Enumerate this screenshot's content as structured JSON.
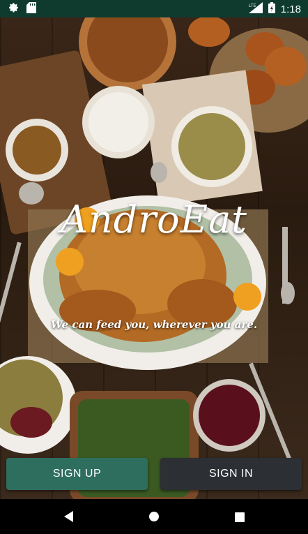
{
  "status_bar": {
    "time": "1:18",
    "network": "LTE",
    "icons": [
      "gear-icon",
      "sd-card-icon",
      "signal-icon",
      "battery-icon"
    ]
  },
  "app": {
    "title": "AndroEat",
    "tagline": "We can feed you, wherever you are."
  },
  "buttons": {
    "sign_up": "SIGN UP",
    "sign_in": "SIGN IN"
  },
  "nav": {
    "icons": [
      "back-icon",
      "home-icon",
      "recents-icon"
    ]
  },
  "colors": {
    "status_bar": "#0f3b2f",
    "sign_up": "#2e6e5f",
    "sign_in": "#2c2f33"
  }
}
